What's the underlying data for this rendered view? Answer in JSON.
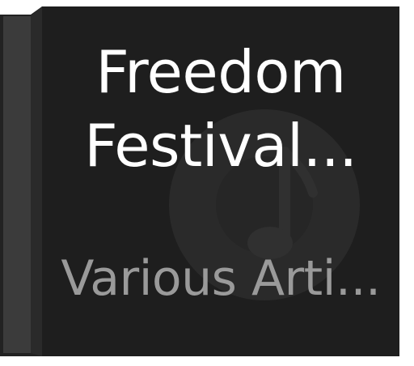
{
  "album": {
    "title_line1": "Freedom",
    "title_line2": "Festival...",
    "artist": "Various Arti...",
    "placeholder_icon": "music-note-icon"
  },
  "colors": {
    "cover_background": "#1e1e1e",
    "title_text": "#ffffff",
    "artist_text": "#9a9a9a",
    "spine_face": "#3a3a3a",
    "spine_edge": "#222222"
  }
}
